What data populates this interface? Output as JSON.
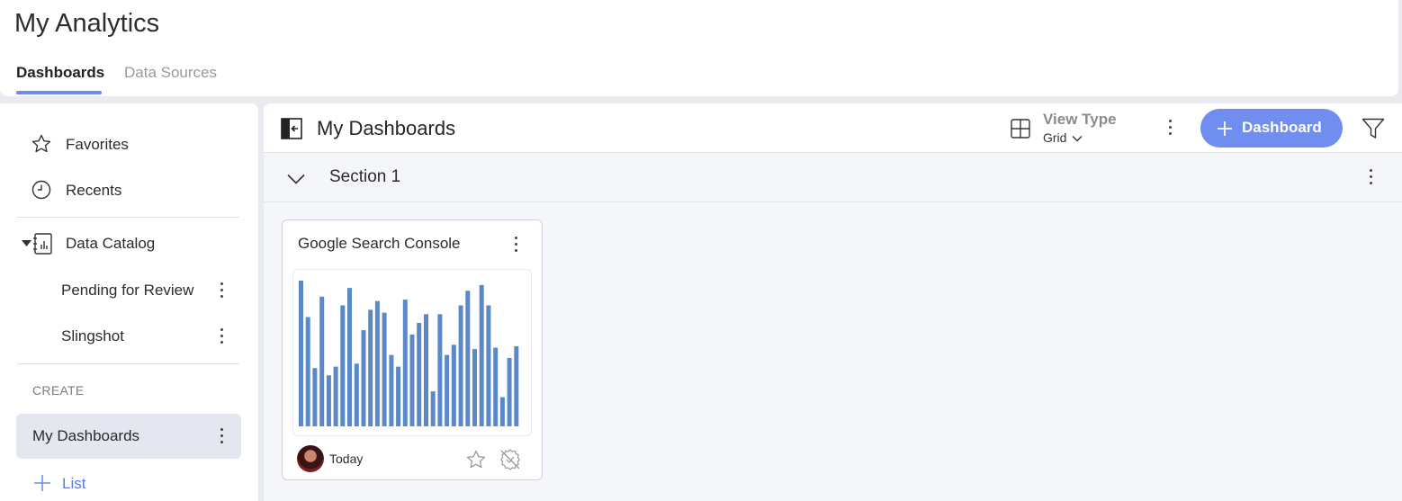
{
  "app": {
    "title": "My Analytics"
  },
  "tabs": [
    {
      "label": "Dashboards",
      "active": true
    },
    {
      "label": "Data Sources",
      "active": false
    }
  ],
  "sidebar": {
    "favorites": "Favorites",
    "recents": "Recents",
    "data_catalog": "Data Catalog",
    "catalog_children": [
      "Pending for Review",
      "Slingshot"
    ],
    "create_label": "CREATE",
    "my_dashboards": "My Dashboards",
    "add_list": "List"
  },
  "main": {
    "title": "My Dashboards",
    "view_type_label": "View Type",
    "view_type_value": "Grid",
    "add_button": "Dashboard",
    "section_title": "Section 1"
  },
  "card": {
    "title": "Google Search Console",
    "date": "Today"
  },
  "colors": {
    "accent": "#6f8ef0",
    "bar": "#5b88c9",
    "tab_underline": "#6e8ce8"
  },
  "chart_data": {
    "type": "bar",
    "values": [
      100,
      75,
      40,
      89,
      35,
      41,
      83,
      95,
      43,
      66,
      80,
      86,
      78,
      49,
      41,
      87,
      63,
      71,
      77,
      24,
      77,
      49,
      56,
      83,
      93,
      53,
      97,
      83,
      54,
      20,
      47,
      55
    ]
  }
}
